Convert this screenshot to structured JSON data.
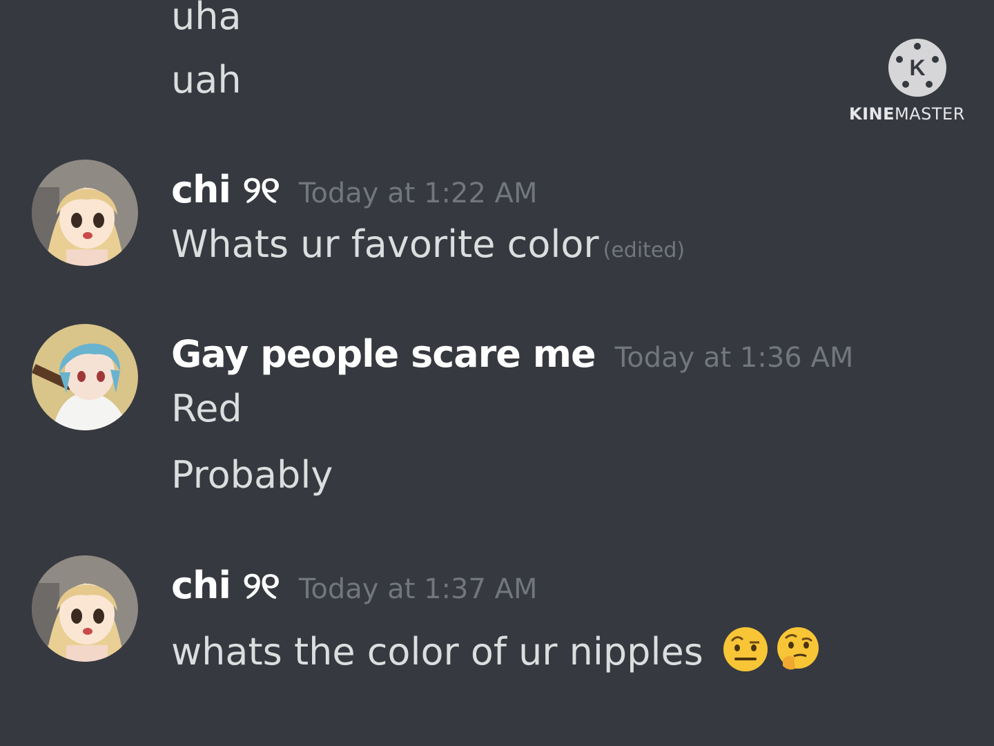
{
  "watermark": {
    "logo_letter": "K",
    "label_bold": "KINE",
    "label_regular": "MASTER"
  },
  "messages": [
    {
      "text": "uha"
    },
    {
      "text": "uah"
    },
    {
      "author": "chi ୨୧",
      "timestamp": "Today at 1:22 AM",
      "avatar_icon": "anime-girl-blonde-avatar",
      "lines": [
        "Whats ur favorite color"
      ],
      "edited_label": "(edited)"
    },
    {
      "author": "Gay people scare me",
      "timestamp": "Today at 1:36 AM",
      "avatar_icon": "anime-girl-blue-hair-avatar",
      "lines": [
        "Red",
        "Probably"
      ]
    },
    {
      "author": "chi ୨୧",
      "timestamp": "Today at 1:37 AM",
      "avatar_icon": "anime-girl-blonde-avatar",
      "lines": [
        "whats the color of ur nipples"
      ],
      "emojis": [
        "face-with-raised-eyebrow",
        "thinking-face"
      ]
    }
  ],
  "colors": {
    "background": "#36393f",
    "author": "#ffffff",
    "message": "#dcddde",
    "muted": "#72767d"
  }
}
